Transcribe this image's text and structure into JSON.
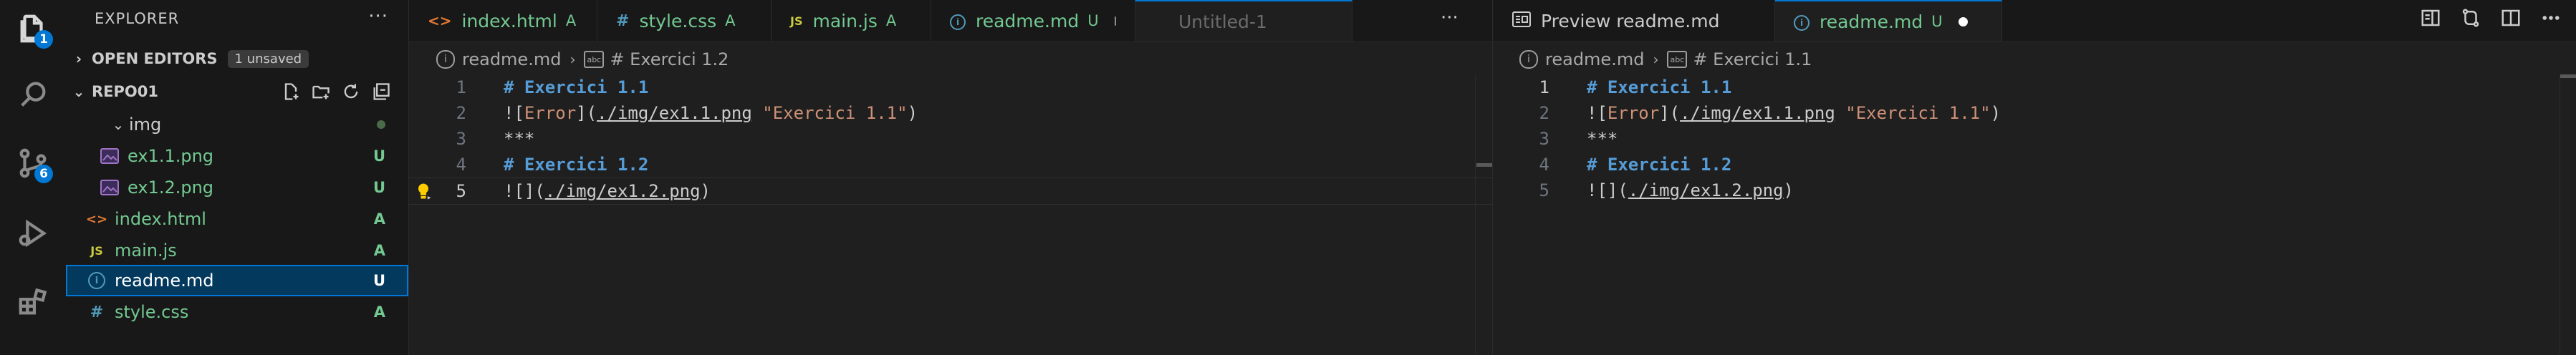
{
  "activity": {
    "explorer_badge": "1",
    "scm_badge": "6"
  },
  "sidebar": {
    "title": "EXPLORER",
    "more": "···",
    "open_editors": {
      "label": "OPEN EDITORS",
      "badge": "1 unsaved"
    },
    "repo": {
      "label": "REPO01"
    },
    "tree": [
      {
        "name": "img",
        "kind": "folder",
        "status": ""
      },
      {
        "name": "ex1.1.png",
        "kind": "image",
        "status": "U"
      },
      {
        "name": "ex1.2.png",
        "kind": "image",
        "status": "U"
      },
      {
        "name": "index.html",
        "kind": "html",
        "status": "A"
      },
      {
        "name": "main.js",
        "kind": "js",
        "status": "A"
      },
      {
        "name": "readme.md",
        "kind": "md",
        "status": "U"
      },
      {
        "name": "style.css",
        "kind": "css",
        "status": "A"
      }
    ]
  },
  "group1": {
    "tabs": [
      {
        "label": "index.html",
        "icon": "<>",
        "status": "A"
      },
      {
        "label": "style.css",
        "icon": "#",
        "status": "A"
      },
      {
        "label": "main.js",
        "icon": "JS",
        "status": "A"
      },
      {
        "label": "readme.md",
        "icon": "ⓘ",
        "status": "U"
      },
      {
        "label": "Untitled-1",
        "icon": "",
        "status": ""
      }
    ],
    "more": "···",
    "breadcrumb": {
      "file": "readme.md",
      "symbol": "# Exercici 1.2"
    },
    "lines": [
      "1",
      "2",
      "3",
      "4",
      "5"
    ]
  },
  "group2": {
    "tabs": [
      {
        "label": "Preview readme.md"
      },
      {
        "label": "readme.md",
        "status": "U"
      }
    ],
    "breadcrumb": {
      "file": "readme.md",
      "symbol": "# Exercici 1.1"
    },
    "lines": [
      "1",
      "2",
      "3",
      "4",
      "5"
    ]
  },
  "code": {
    "l1": "# Exercici 1.1",
    "l2_bang": "![",
    "l2_alt": "Error",
    "l2_mid": "](",
    "l2_url": "./img/ex1.1.png",
    "l2_title": "\"Exercici 1.1\"",
    "l2_end": ")",
    "l3": "***",
    "l4": "# Exercici 1.2",
    "l5_start": "![](",
    "l5_url": "./img/ex1.2.png",
    "l5_end": ")"
  },
  "colors": {
    "accent": "#0078d4",
    "added": "#73c991",
    "untracked": "#73c991",
    "heading": "#569cd6",
    "string": "#ce9178"
  }
}
